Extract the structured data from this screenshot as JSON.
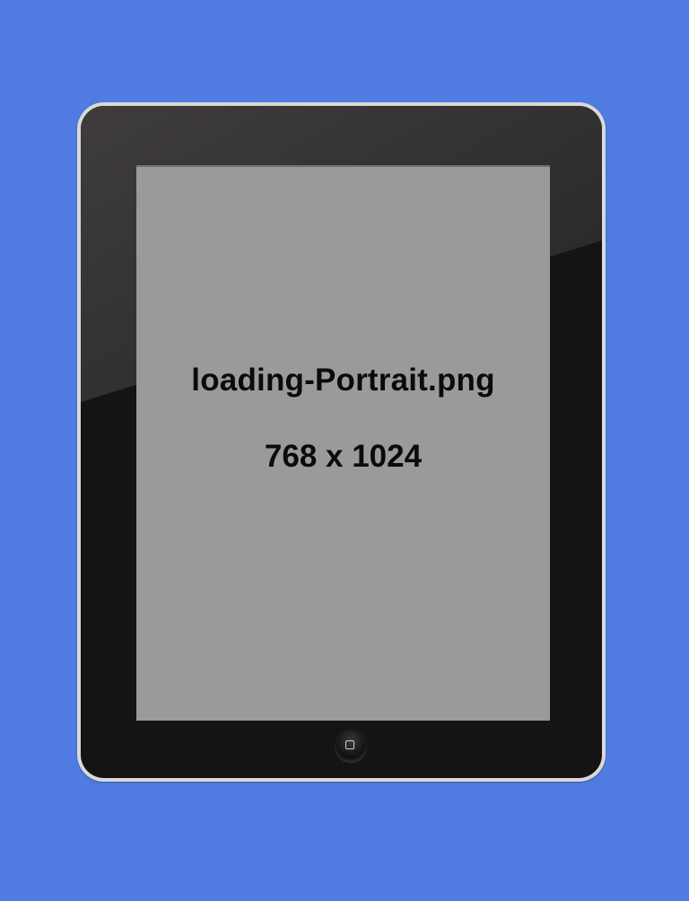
{
  "theme": {
    "background": "#507be0",
    "bezel": "#151313",
    "screen": "#9a9a9a"
  },
  "screen": {
    "filename": "loading-Portrait.png",
    "dimensions": "768 x 1024"
  },
  "device": {
    "home_button_icon": "home-square-icon"
  }
}
